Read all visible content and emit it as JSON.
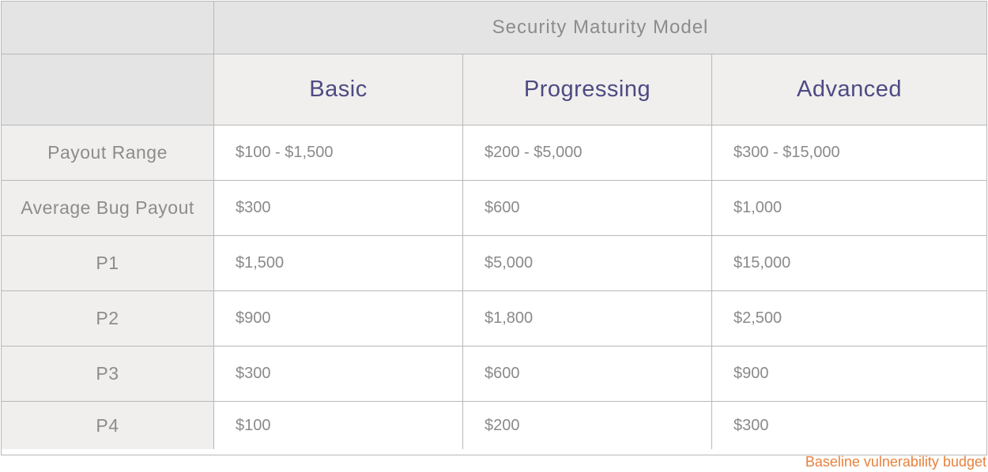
{
  "table": {
    "title": "Security Maturity Model",
    "levels": [
      "Basic",
      "Progressing",
      "Advanced"
    ],
    "rows": [
      {
        "label": "Payout Range",
        "values": [
          "$100 - $1,500",
          "$200 - $5,000",
          "$300 - $15,000"
        ]
      },
      {
        "label": "Average Bug Payout",
        "values": [
          "$300",
          "$600",
          "$1,000"
        ]
      },
      {
        "label": "P1",
        "values": [
          "$1,500",
          "$5,000",
          "$15,000"
        ]
      },
      {
        "label": "P2",
        "values": [
          "$900",
          "$1,800",
          "$2,500"
        ]
      },
      {
        "label": "P3",
        "values": [
          "$300",
          "$600",
          "$900"
        ]
      },
      {
        "label": "P4",
        "values": [
          "$100",
          "$200",
          "$300"
        ]
      }
    ]
  },
  "caption": "Baseline vulnerability budget",
  "colors": {
    "header_bg": "#e5e4e4",
    "label_bg": "#f0efee",
    "level_text": "#4d4a82",
    "body_text": "#8a8a8a",
    "caption_text": "#e8813d"
  }
}
